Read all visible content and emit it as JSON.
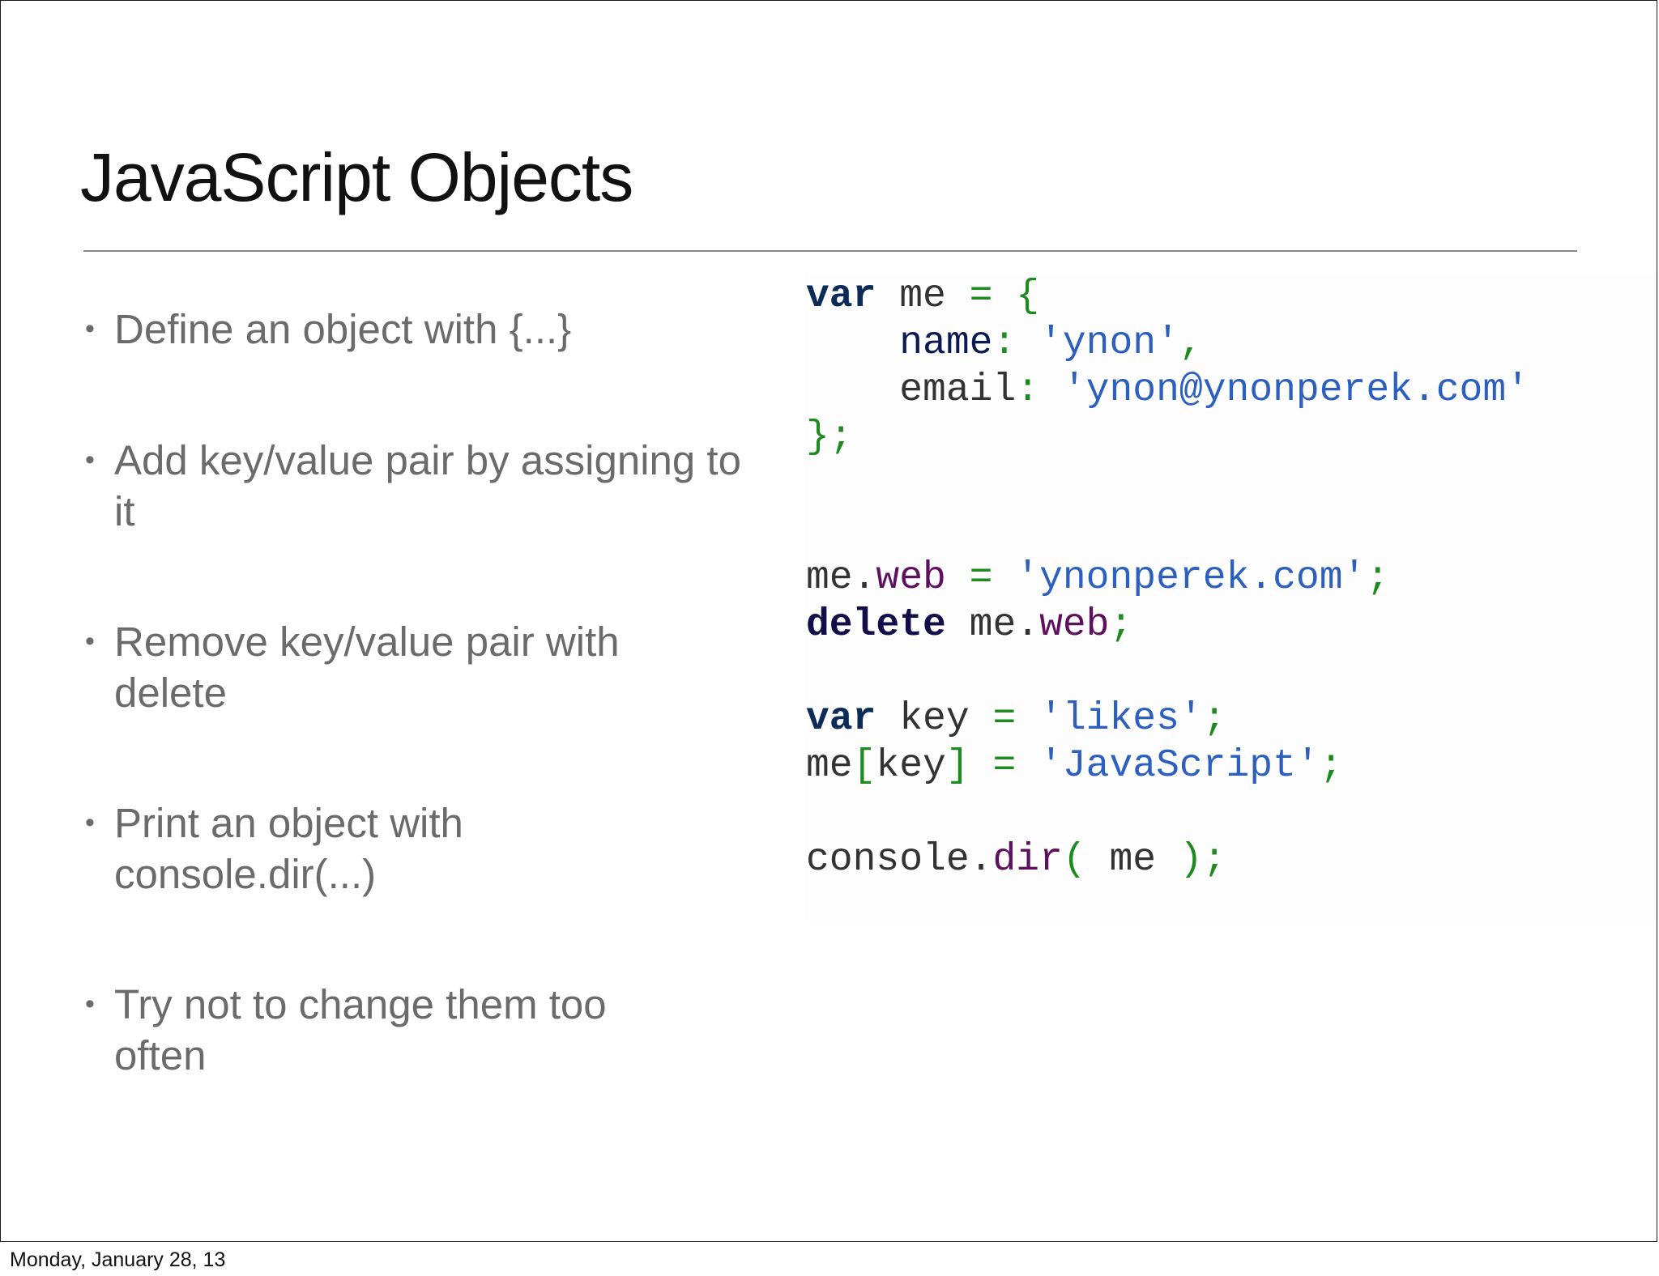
{
  "slide": {
    "title": "JavaScript Objects",
    "bullets": [
      {
        "marker": "•",
        "text": "Define an object with {...}"
      },
      {
        "marker": "•",
        "text": "Add key/value pair by assigning to it"
      },
      {
        "marker": "•",
        "text": "Remove key/value pair with delete"
      },
      {
        "marker": "•",
        "text": "Print an object with console.dir(...)"
      },
      {
        "marker": "•",
        "text": "Try not to change them too often"
      }
    ],
    "code": {
      "l1": {
        "kw": "var",
        "id": " me ",
        "op": "= {"
      },
      "l2": {
        "indent": "    ",
        "prop": "name",
        "op": ": ",
        "str": "'ynon'",
        "op2": ","
      },
      "l3": {
        "indent": "    ",
        "id": "email",
        "op": ": ",
        "str": "'ynon@ynonperek.com'"
      },
      "l4": {
        "op": "};"
      },
      "l5": {
        "id": "me",
        "dot": ".",
        "mem": "web",
        "op": " = ",
        "str": "'ynonperek.com'",
        "op2": ";"
      },
      "l6": {
        "kw": "delete",
        "id": " me",
        "dot": ".",
        "mem": "web",
        "op": ";"
      },
      "l7": {
        "kw": "var",
        "id": " key ",
        "op": "= ",
        "str": "'likes'",
        "op2": ";"
      },
      "l8": {
        "id": "me",
        "op": "[",
        "id2": "key",
        "op2": "] = ",
        "str": "'JavaScript'",
        "op3": ";"
      },
      "l9": {
        "id": "console",
        "dot": ".",
        "mem": "dir",
        "op": "( ",
        "id2": "me",
        "op2": " );"
      }
    }
  },
  "footer": {
    "date": "Monday, January 28, 13"
  },
  "colors": {
    "keyword": "#0c2b57",
    "string": "#2d5fbf",
    "operator": "#1f8a1f",
    "member": "#5e0f5e",
    "bullet_text": "#6b6b6b"
  }
}
